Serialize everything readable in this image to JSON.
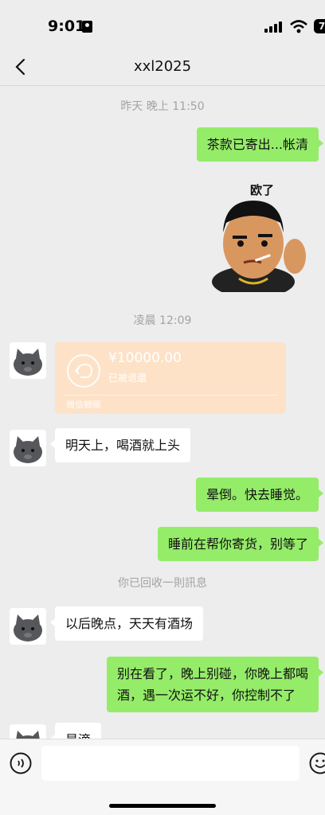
{
  "status_bar": {
    "time": "9:01",
    "battery": "7"
  },
  "header": {
    "title": "xxl2025"
  },
  "messages": {
    "time_1": "昨天 晚上 11:50",
    "m1": "茶款已寄出...帐清",
    "sticker_text": "欧了",
    "time_2": "凌晨 12:09",
    "transfer": {
      "amount": "¥10000.00",
      "status": "已被退還",
      "footer": "微信轉賬"
    },
    "m2": "明天上，喝酒就上头",
    "m3": "晕倒。快去睡觉。",
    "m4": "睡前在帮你寄货，别等了",
    "recall": "你已回收一則訊息",
    "m5": "以后晚点，天天有酒场",
    "m6_line1": "别在看了，晚上别碰，你晚上都喝",
    "m6_line2": "酒，遇一次运不好，你控制不了",
    "m7": "是滴"
  },
  "input": {
    "placeholder": ""
  },
  "colors": {
    "me_bubble": "#95ec69",
    "them_bubble": "#ffffff",
    "background": "#ededed",
    "transfer": "#fde2c8"
  }
}
